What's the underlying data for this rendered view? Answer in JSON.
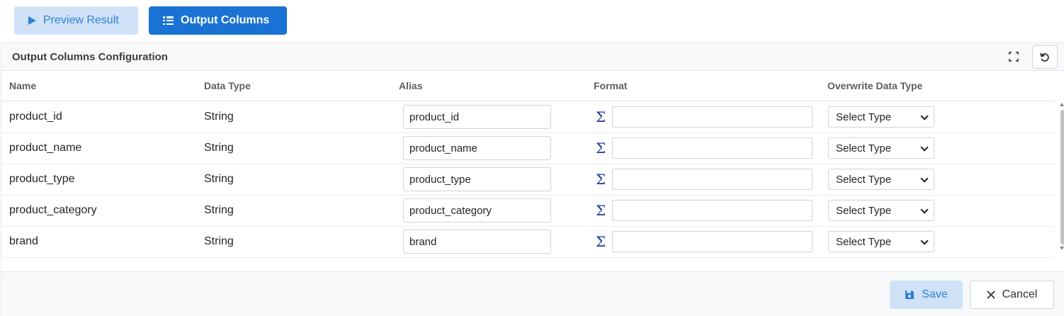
{
  "tabs": {
    "preview_label": "Preview Result",
    "output_label": "Output Columns"
  },
  "panel": {
    "title": "Output Columns Configuration",
    "icons": {
      "expand": "expand-icon",
      "reset": "refresh-icon"
    }
  },
  "table": {
    "headers": {
      "name": "Name",
      "data_type": "Data Type",
      "alias": "Alias",
      "format": "Format",
      "overwrite": "Overwrite Data Type"
    },
    "rows": [
      {
        "name": "product_id",
        "data_type": "String",
        "alias": "product_id",
        "format": "",
        "overwrite": "Select Type"
      },
      {
        "name": "product_name",
        "data_type": "String",
        "alias": "product_name",
        "format": "",
        "overwrite": "Select Type"
      },
      {
        "name": "product_type",
        "data_type": "String",
        "alias": "product_type",
        "format": "",
        "overwrite": "Select Type"
      },
      {
        "name": "product_category",
        "data_type": "String",
        "alias": "product_category",
        "format": "",
        "overwrite": "Select Type"
      },
      {
        "name": "brand",
        "data_type": "String",
        "alias": "brand",
        "format": "",
        "overwrite": "Select Type"
      }
    ],
    "format_icon": "sigma-icon"
  },
  "footer": {
    "save_label": "Save",
    "cancel_label": "Cancel"
  },
  "colors": {
    "primary": "#1a73d4",
    "primary_light": "#cfe2f7",
    "primary_text": "#2f7fd6",
    "sigma": "#1f3a9e"
  }
}
